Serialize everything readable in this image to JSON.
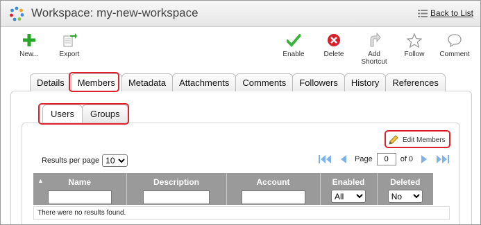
{
  "header": {
    "title": "Workspace: my-new-workspace",
    "back_label": "Back to List"
  },
  "toolbar": {
    "new_label": "New...",
    "export_label": "Export",
    "enable_label": "Enable",
    "delete_label": "Delete",
    "add_shortcut_label": "Add\nShortcut",
    "follow_label": "Follow",
    "comment_label": "Comment"
  },
  "tabs": [
    "Details",
    "Members",
    "Metadata",
    "Attachments",
    "Comments",
    "Followers",
    "History",
    "References"
  ],
  "active_tab": "Members",
  "subtabs": [
    "Users",
    "Groups"
  ],
  "active_subtab": "Users",
  "edit_members_label": "Edit Members",
  "results_per_page": {
    "label": "Results per page",
    "value": "10",
    "options": [
      "10"
    ]
  },
  "pager": {
    "page_label": "Page",
    "page_value": "0",
    "of_label": "of 0"
  },
  "grid": {
    "columns": [
      "Name",
      "Description",
      "Account",
      "Enabled",
      "Deleted"
    ],
    "enabled_filter": "All",
    "deleted_filter": "No",
    "empty_message": "There were no results found."
  },
  "colors": {
    "highlight": "#e0202c",
    "header_bg": "#9a9a9a",
    "pager_blue": "#3a8fd9"
  }
}
